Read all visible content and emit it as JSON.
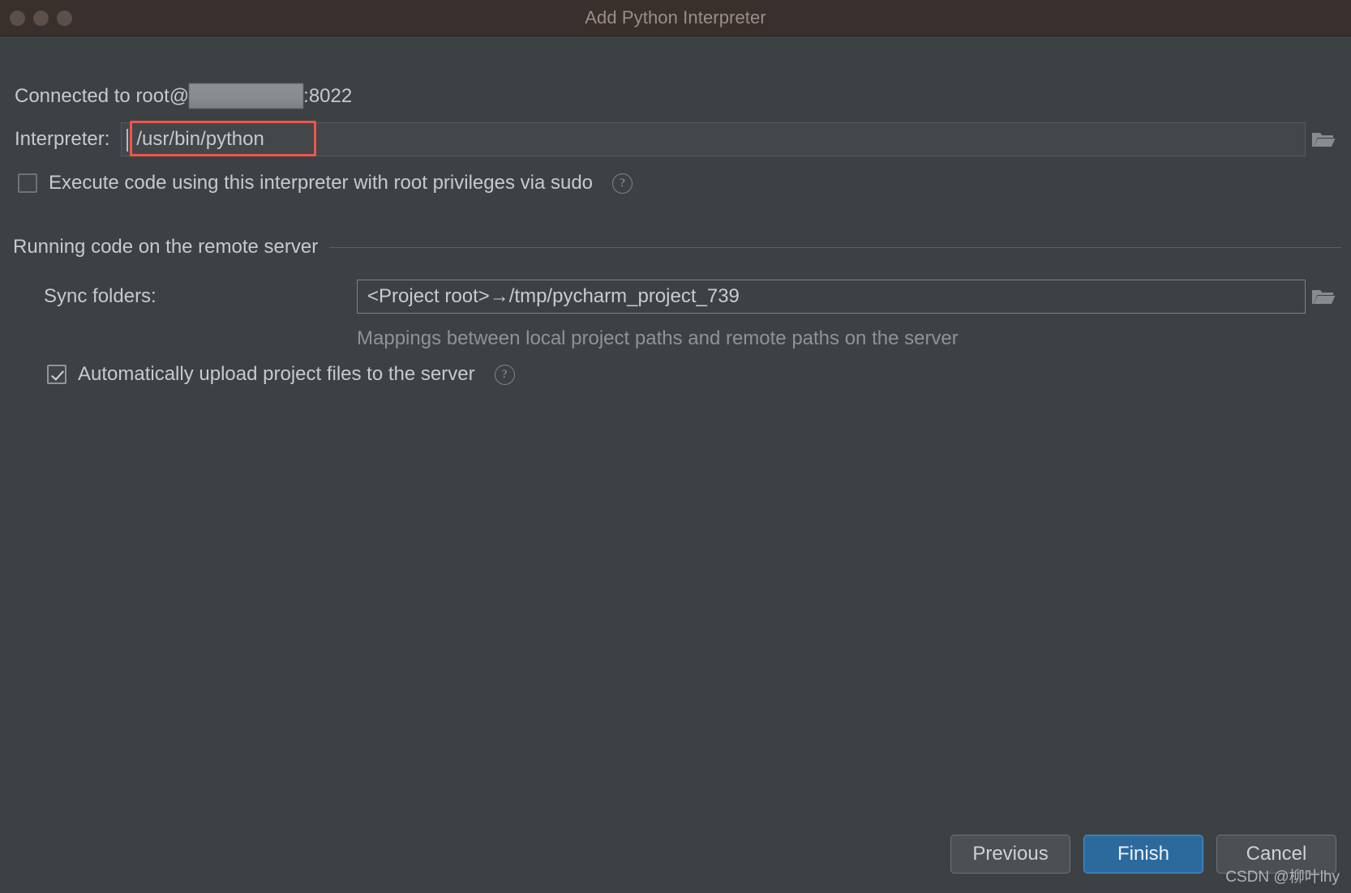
{
  "window": {
    "title": "Add Python Interpreter",
    "traffic_lights": [
      "close",
      "minimize",
      "zoom"
    ]
  },
  "connection": {
    "prefix": "Connected to root@",
    "host_redacted": true,
    "suffix": ":8022"
  },
  "interpreter": {
    "label": "Interpreter:",
    "value": "/usr/bin/python",
    "browse_icon": "folder-open-icon",
    "annotation_color": "#f2554b"
  },
  "sudo": {
    "label": "Execute code using this interpreter with root privileges via sudo",
    "checked": false,
    "help_icon": "question-mark-icon",
    "help_glyph": "?"
  },
  "remote_section": {
    "title": "Running code on the remote server",
    "sync": {
      "label": "Sync folders:",
      "value": "<Project root>→/tmp/pycharm_project_739",
      "browse_icon": "folder-open-icon"
    },
    "hint": "Mappings between local project paths and remote paths on the server",
    "auto_upload": {
      "label": "Automatically upload project files to the server",
      "checked": true,
      "help_icon": "question-mark-icon",
      "help_glyph": "?"
    }
  },
  "footer": {
    "previous_label": "Previous",
    "finish_label": "Finish",
    "cancel_label": "Cancel",
    "primary_color": "#2c6a9e"
  },
  "watermark": "CSDN @柳叶lhy"
}
